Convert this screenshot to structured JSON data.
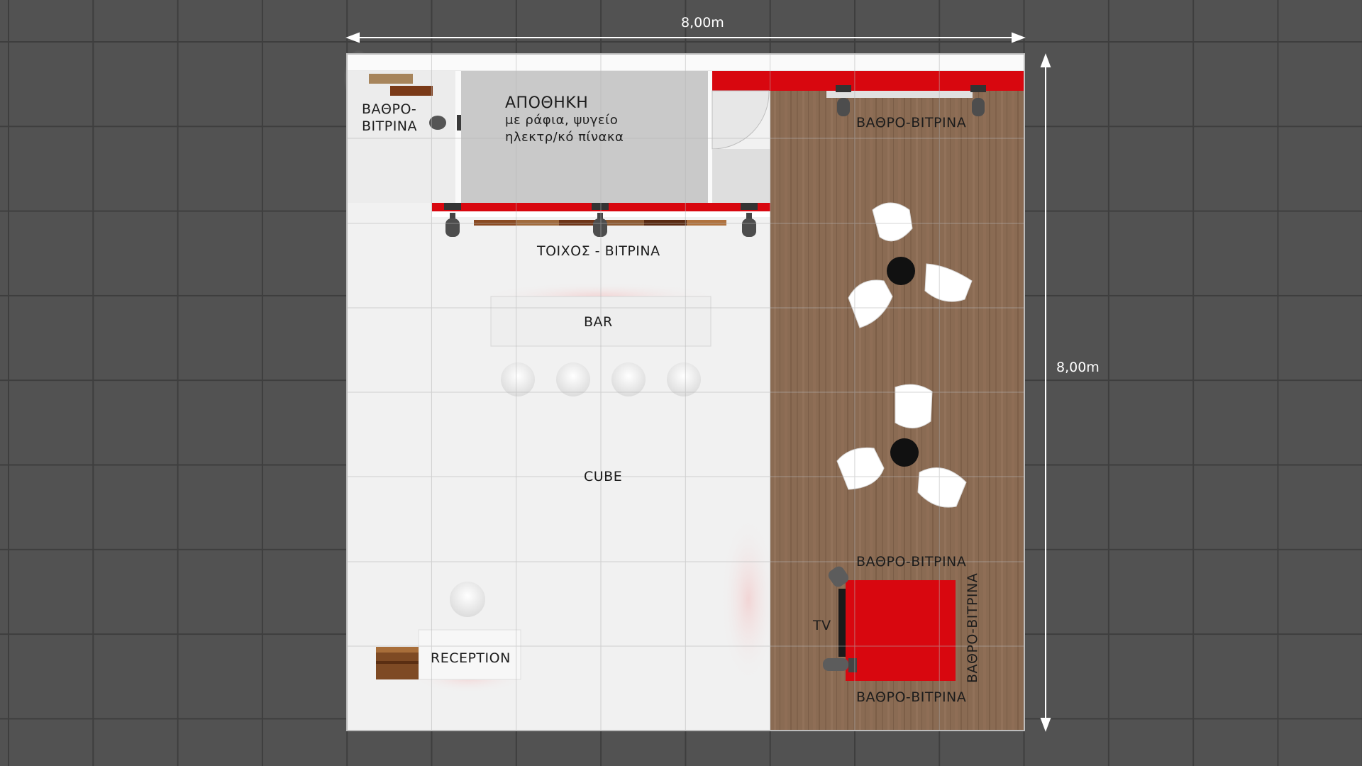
{
  "dimensions": {
    "width": "8,00m",
    "height": "8,00m"
  },
  "labels": {
    "vathro_top_left_1": "ΒΑΘΡΟ-",
    "vathro_top_left_2": "ΒΙΤΡΙΝΑ",
    "storage_title": "ΑΠΟΘΗΚΗ",
    "storage_line1": "με ράφια, ψυγείο",
    "storage_line2": "ηλεκτρ/κό πίνακα",
    "vathro_top_right": "ΒΑΘΡΟ-ΒΙΤΡΙΝΑ",
    "wall_showcase": "ΤΟΙΧΟΣ - ΒΙΤΡΙΝΑ",
    "bar": "BAR",
    "cube": "CUBE",
    "reception": "RECEPTION",
    "tv": "TV",
    "vathro_red_top": "ΒΑΘΡΟ-ΒΙΤΡΙΝΑ",
    "vathro_red_bottom": "ΒΑΘΡΟ-ΒΙΤΡΙΝΑ",
    "vathro_red_side": "ΒΑΘΡΟ-ΒΙΤΡΙΝΑ"
  },
  "colors": {
    "brand_red": "#d8070f",
    "floor_white": "#f1f1f1",
    "wood": "#8a6b53",
    "background": "#525252"
  }
}
